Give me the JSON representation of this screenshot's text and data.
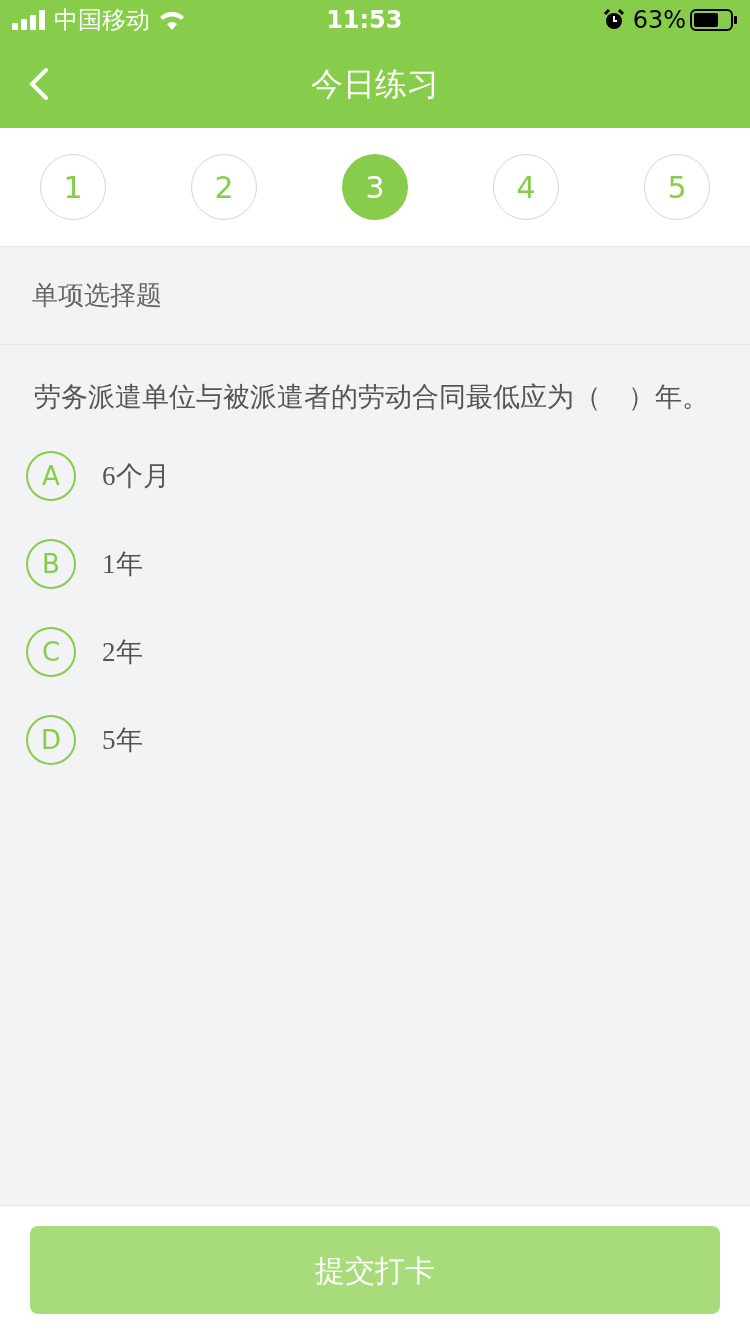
{
  "status_bar": {
    "carrier": "中国移动",
    "time": "11:53",
    "battery": "63%"
  },
  "nav": {
    "title": "今日练习"
  },
  "steps": [
    {
      "label": "1",
      "selected": false
    },
    {
      "label": "2",
      "selected": false
    },
    {
      "label": "3",
      "selected": true
    },
    {
      "label": "4",
      "selected": false
    },
    {
      "label": "5",
      "selected": false
    }
  ],
  "question": {
    "type": "单项选择题",
    "text": "劳务派遣单位与被派遣者的劳动合同最低应为（　）年。",
    "options": [
      {
        "letter": "A",
        "text": "6个月",
        "selected": false
      },
      {
        "letter": "B",
        "text": "1年",
        "selected": false
      },
      {
        "letter": "C",
        "text": "2年",
        "selected": false
      },
      {
        "letter": "D",
        "text": "5年",
        "selected": false
      }
    ]
  },
  "submit": {
    "label": "提交打卡",
    "disabled": true
  }
}
